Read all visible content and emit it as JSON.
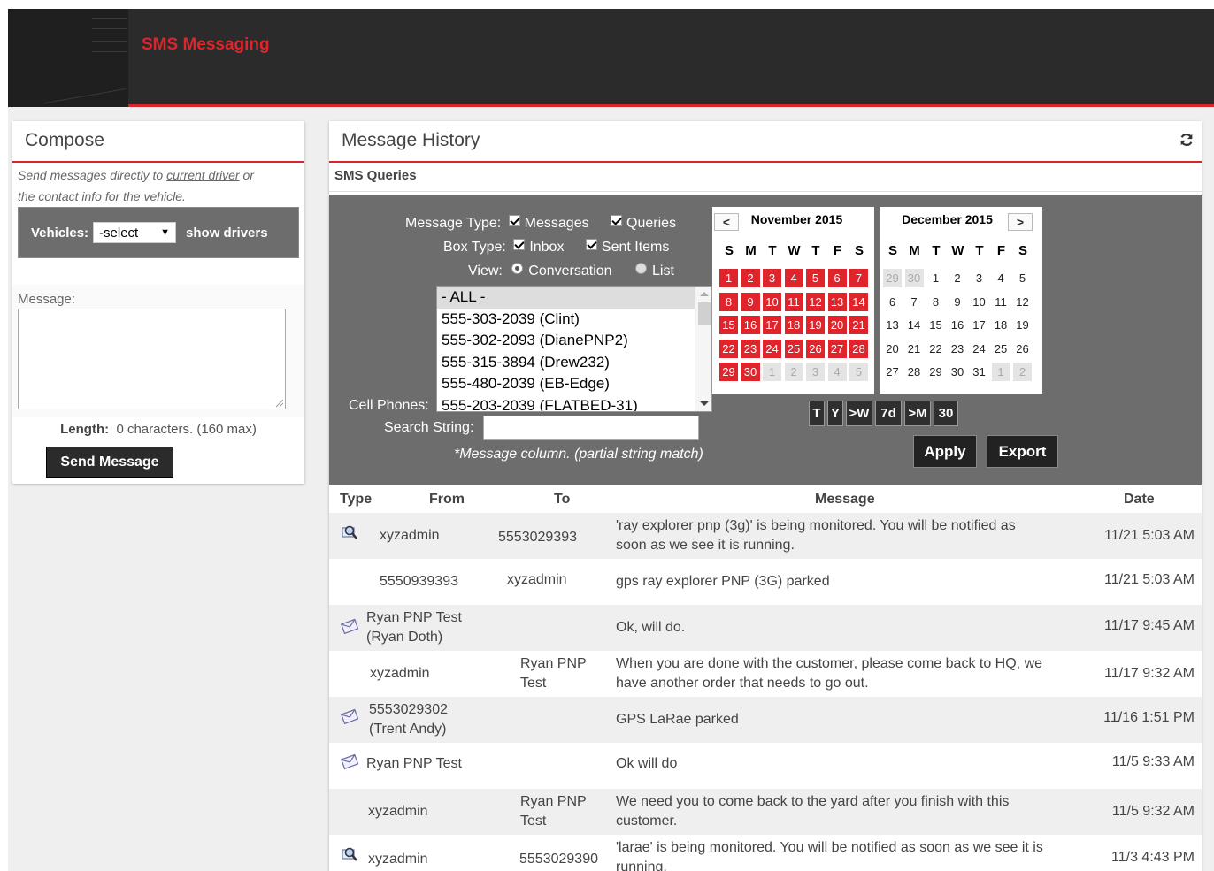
{
  "app": {
    "title": "SMS Messaging"
  },
  "compose": {
    "title": "Compose",
    "intro_1": "Send messages directly to ",
    "intro_link_driver": "current driver",
    "intro_2": " or",
    "intro_3": "the ",
    "intro_link_contact": "contact info",
    "intro_4": " for the vehicle.",
    "vehicles_label": "Vehicles:",
    "vehicles_value": "-select",
    "show_drivers": "show drivers",
    "message_label": "Message:",
    "length_label": "Length:",
    "length_value": "0 characters. (160 max)",
    "send_button": "Send Message"
  },
  "history": {
    "title": "Message History",
    "subtitle": "SMS Queries",
    "filters": {
      "message_type_label": "Message Type:",
      "messages": "Messages",
      "queries": "Queries",
      "box_type_label": "Box Type:",
      "inbox": "Inbox",
      "sent_items": "Sent Items",
      "view_label": "View:",
      "conversation": "Conversation",
      "list": "List",
      "cell_phones_label": "Cell Phones:",
      "phones": [
        "- ALL -",
        "555-303-2039 (Clint)",
        "555-302-2093 (DianePNP2)",
        "555-315-3894 (Drew232)",
        "555-480-2039 (EB-Edge)",
        "555-203-2039 (FLATBED-31)"
      ],
      "search_label": "Search String:",
      "search_value": "",
      "hint": "*Message column. (partial string match)"
    },
    "calendars": {
      "left_title": "November 2015",
      "right_title": "December 2015",
      "prev": "<",
      "next": ">",
      "dow": [
        "S",
        "M",
        "T",
        "W",
        "T",
        "F",
        "S"
      ]
    },
    "quick_buttons": [
      "T",
      "Y",
      ">W",
      "7d",
      ">M",
      "30"
    ],
    "apply": "Apply",
    "export": "Export",
    "columns": {
      "type": "Type",
      "from": "From",
      "to": "To",
      "message": "Message",
      "date": "Date"
    },
    "rows": [
      {
        "icon": "query",
        "from": "xyzadmin",
        "to": "5553029393",
        "msg1": "'ray explorer pnp (3g)' is being monitored. You will be notified as",
        "msg2": "soon as we see it is running.",
        "date": "11/21 5:03 AM"
      },
      {
        "icon": "",
        "from": "5550939393",
        "to": "xyzadmin",
        "msg1": "gps ray explorer PNP (3G) parked",
        "msg2": "",
        "date": "11/21 5:03 AM"
      },
      {
        "icon": "envelope",
        "from1": "Ryan PNP Test",
        "from2": "(Ryan Doth)",
        "to": "",
        "msg1": "Ok, will do.",
        "msg2": "",
        "date": "11/17 9:45 AM"
      },
      {
        "icon": "",
        "from": "xyzadmin",
        "to1": "Ryan PNP",
        "to2": "Test",
        "msg1": "When you are done with the customer, please come back to HQ, we",
        "msg2": "have another order that needs to go out.",
        "date": "11/17 9:32 AM"
      },
      {
        "icon": "envelope",
        "from1": "5553029302",
        "from2": "(Trent Andy)",
        "to": "",
        "msg1": "GPS LaRae parked",
        "msg2": "",
        "date": "11/16 1:51 PM"
      },
      {
        "icon": "envelope",
        "from": "Ryan PNP Test",
        "to": "",
        "msg1": "Ok will do",
        "msg2": "",
        "date": "11/5 9:33 AM"
      },
      {
        "icon": "",
        "from": "xyzadmin",
        "to1": "Ryan PNP",
        "to2": "Test",
        "msg1": "We need you to come back to the yard after you finish with this",
        "msg2": "customer.",
        "date": "11/5 9:32 AM"
      },
      {
        "icon": "query",
        "from": "xyzadmin",
        "to": "5553029390",
        "msg1": "'larae' is being monitored. You will be notified as soon as we see it is",
        "msg2": "running.",
        "date": "11/3 4:43 PM"
      }
    ]
  },
  "colors": {
    "accent": "#e0242b",
    "header": "#2b2b2b",
    "filter_bg": "#6d6d6d"
  }
}
